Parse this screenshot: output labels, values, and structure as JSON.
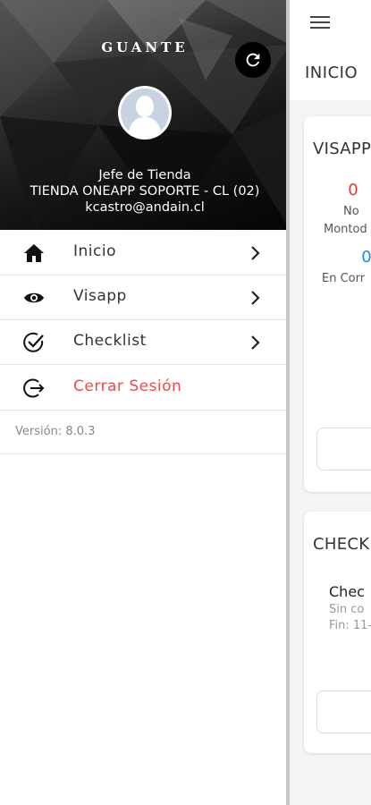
{
  "app": {
    "page_title": "INICIO",
    "visapp_card": {
      "title": "VISAPP",
      "stats": [
        {
          "value": "0",
          "label": "No",
          "label2": "Montod",
          "color": "#e53935"
        },
        {
          "value": "0",
          "label": "En Corr",
          "color": "#1e88e5"
        }
      ]
    },
    "checklist_card": {
      "title": "CHECK",
      "item_name": "Chec",
      "item_sub1": "Sin co",
      "item_sub2": "Fin: 11-"
    }
  },
  "drawer": {
    "brand": "GUANTE",
    "refresh_icon": "refresh-icon",
    "user": {
      "role": "Jefe de Tienda",
      "store": "TIENDA ONEAPP SOPORTE - CL (02)",
      "email": "kcastro@andain.cl"
    },
    "menu": [
      {
        "label": "Inicio",
        "icon": "home-icon"
      },
      {
        "label": "Visapp",
        "icon": "eye-icon"
      },
      {
        "label": "Checklist",
        "icon": "check-circle-icon"
      },
      {
        "label": "Cerrar Sesión",
        "icon": "logout-icon",
        "color": "#ee4b4b"
      }
    ],
    "version": "Versión: 8.0.3"
  }
}
